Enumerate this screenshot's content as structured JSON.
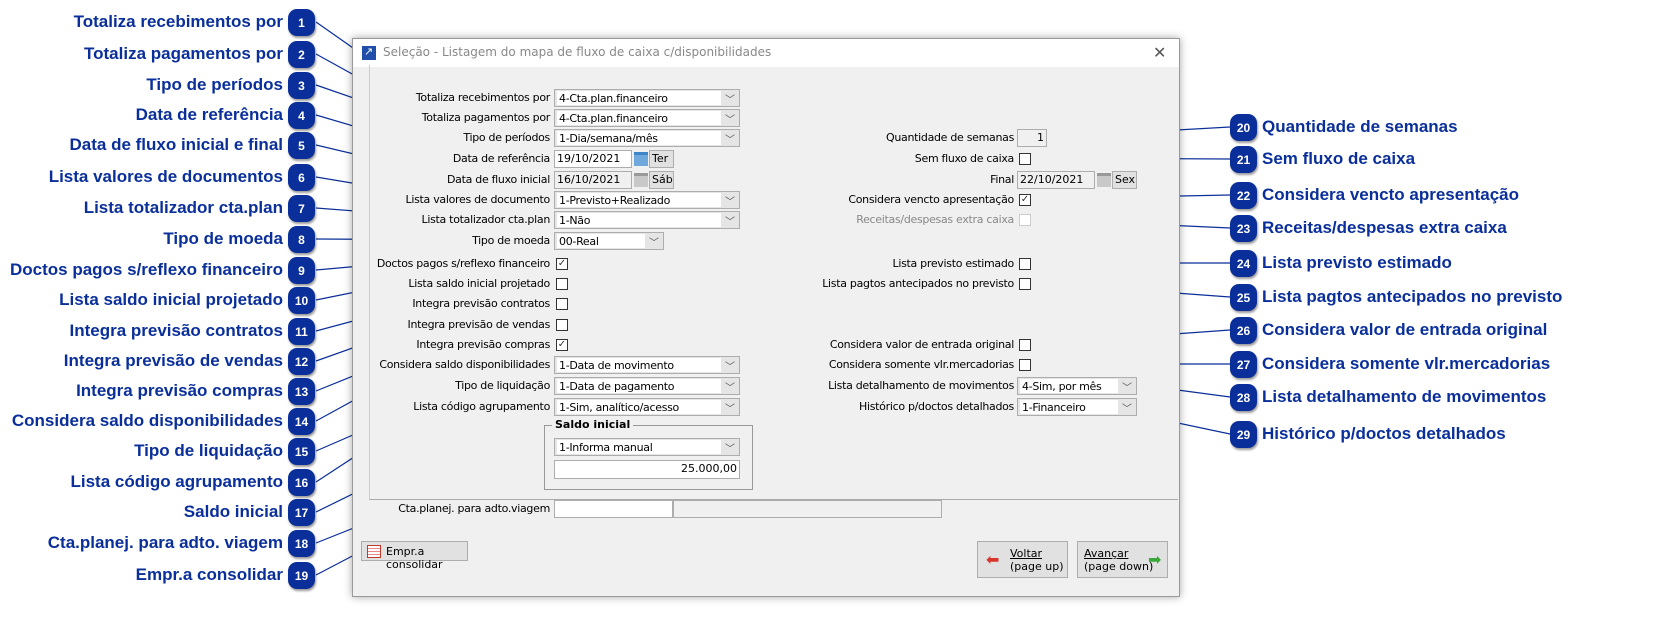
{
  "callouts_left": [
    "Totaliza recebimentos por",
    "Totaliza pagamentos por",
    "Tipo de períodos",
    "Data de referência",
    "Data de fluxo inicial e final",
    "Lista valores de documentos",
    "Lista totalizador cta.plan",
    "Tipo de moeda",
    "Doctos pagos s/reflexo financeiro",
    "Lista saldo inicial projetado",
    "Integra previsão contratos",
    "Integra previsão de vendas",
    "Integra previsão compras",
    "Considera saldo disponibilidades",
    "Tipo de liquidação",
    "Lista código agrupamento",
    "Saldo inicial",
    "Cta.planej. para  adto. viagem",
    "Empr.a consolidar"
  ],
  "callouts_right": [
    "Quantidade de semanas",
    "Sem fluxo de caixa",
    "Considera vencto apresentação",
    "Receitas/despesas extra caixa",
    "Lista previsto estimado",
    "Lista pagtos antecipados no previsto",
    "Considera valor de entrada original",
    "Considera somente vlr.mercadorias",
    "Lista detalhamento de movimentos",
    "Histórico p/doctos detalhados"
  ],
  "badges_left": [
    "1",
    "2",
    "3",
    "4",
    "5",
    "6",
    "7",
    "8",
    "9",
    "10",
    "11",
    "12",
    "13",
    "14",
    "15",
    "16",
    "17",
    "18",
    "19"
  ],
  "badges_right": [
    "20",
    "21",
    "22",
    "23",
    "24",
    "25",
    "26",
    "27",
    "28",
    "29"
  ],
  "dialog": {
    "title": "Seleção - Listagem do mapa de fluxo de caixa c/disponibilidades",
    "close": "✕"
  },
  "left_fields": [
    {
      "label": "Totaliza recebimentos por",
      "type": "combo",
      "value": "4-Cta.plan.financeiro"
    },
    {
      "label": "Totaliza pagamentos por",
      "type": "combo",
      "value": "4-Cta.plan.financeiro"
    },
    {
      "label": "Tipo de períodos",
      "type": "combo",
      "value": "1-Dia/semana/mês"
    },
    {
      "label": "Data de referência",
      "type": "date",
      "value": "19/10/2021",
      "day": "Ter",
      "enabled": true
    },
    {
      "label": "Data de fluxo inicial",
      "type": "date",
      "value": "16/10/2021",
      "day": "Sáb",
      "enabled": false
    },
    {
      "label": "Lista valores de documento",
      "type": "combo",
      "value": "1-Previsto+Realizado"
    },
    {
      "label": "Lista totalizador cta.plan",
      "type": "combo",
      "value": "1-Não"
    },
    {
      "label": "Tipo de moeda",
      "type": "combo-short",
      "value": "00-Real"
    },
    {
      "label": "Doctos pagos s/reflexo financeiro",
      "type": "check",
      "checked": true
    },
    {
      "label": "Lista saldo inicial projetado",
      "type": "check",
      "checked": false
    },
    {
      "label": "Integra previsão contratos",
      "type": "check",
      "checked": false
    },
    {
      "label": "Integra previsão de vendas",
      "type": "check",
      "checked": false
    },
    {
      "label": "Integra previsão compras",
      "type": "check",
      "checked": true
    },
    {
      "label": "Considera saldo disponibilidades",
      "type": "combo",
      "value": "1-Data de movimento"
    },
    {
      "label": "Tipo de liquidação",
      "type": "combo",
      "value": "1-Data de pagamento"
    },
    {
      "label": "Lista código agrupamento",
      "type": "combo",
      "value": "1-Sim, analítico/acesso"
    }
  ],
  "right_fields": [
    {
      "label": "Quantidade de semanas",
      "type": "num",
      "value": "1"
    },
    {
      "label": "Sem fluxo de caixa",
      "type": "check",
      "checked": false
    },
    {
      "label": "Final",
      "type": "date",
      "value": "22/10/2021",
      "day": "Sex",
      "enabled": false
    },
    {
      "label": "Considera vencto apresentação",
      "type": "check",
      "checked": true
    },
    {
      "label": "Receitas/despesas extra caixa",
      "type": "check",
      "checked": false,
      "disabled": true
    },
    {
      "label": "Lista previsto estimado",
      "type": "check",
      "checked": false
    },
    {
      "label": "Lista pagtos antecipados no previsto",
      "type": "check",
      "checked": false
    },
    {
      "label": "Considera valor de entrada original",
      "type": "check",
      "checked": false
    },
    {
      "label": "Considera somente vlr.mercadorias",
      "type": "check",
      "checked": false
    },
    {
      "label": "Lista detalhamento de movimentos",
      "type": "combo",
      "value": "4-Sim, por mês"
    },
    {
      "label": "Histórico p/doctos detalhados",
      "type": "combo",
      "value": "1-Financeiro"
    }
  ],
  "saldo_inicial": {
    "title": "Saldo inicial",
    "mode": "1-Informa manual",
    "value": "25.000,00"
  },
  "cta_planej": {
    "label": "Cta.planej. para adto.viagem",
    "code": "",
    "description": ""
  },
  "buttons": {
    "empr": "Empr.a consolidar",
    "voltar": "Voltar",
    "voltar_sub": "(page up)",
    "avancar": "Avançar",
    "avancar_sub": "(page down)"
  },
  "colors": {
    "accent": "#0a2f9a"
  }
}
